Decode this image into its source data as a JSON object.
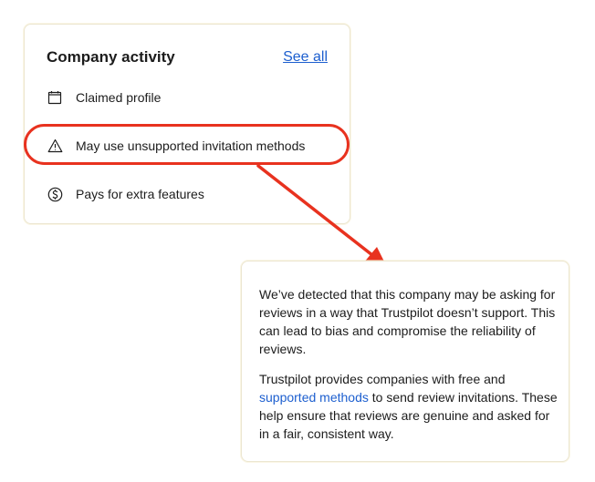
{
  "company_activity": {
    "title": "Company activity",
    "see_all_label": "See all",
    "items": [
      {
        "icon": "calendar-icon",
        "label": "Claimed profile"
      },
      {
        "icon": "warning-triangle-icon",
        "label": "May use unsupported invitation methods"
      },
      {
        "icon": "dollar-circle-icon",
        "label": "Pays for extra features"
      }
    ]
  },
  "tooltip": {
    "paragraph_1": "We’ve detected that this company may be asking for reviews in a way that Trustpilot doesn’t support. This can lead to bias and compromise the reliability of reviews.",
    "paragraph_2_before": "Trustpilot provides companies with free and ",
    "paragraph_2_link": "supported methods",
    "paragraph_2_after": " to send review invitations. These help ensure that reviews are genuine and asked for in a fair, consistent way."
  },
  "colors": {
    "annotation_red": "#e8321f",
    "link_blue": "#1d5fcf",
    "card_border": "#ece6d0",
    "text": "#1c1c1c"
  }
}
